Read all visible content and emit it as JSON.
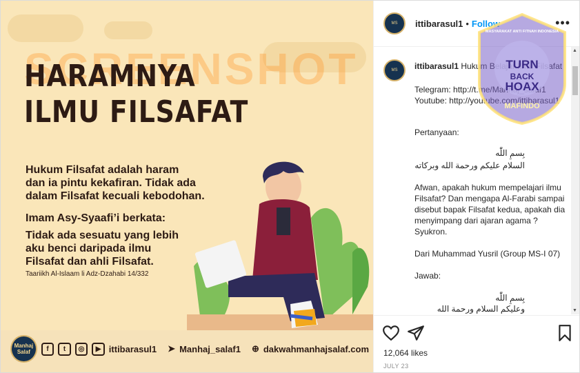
{
  "poster": {
    "title_line1": "HARAMNYA",
    "title_line2": "ILMU FILSAFAT",
    "para1_line1": "Hukum Filsafat adalah haram",
    "para1_line2": "dan ia pintu kekafiran. Tidak ada",
    "para1_line3": "dalam Filsafat kecuali kebodohan.",
    "para2": "Imam Asy-Syaafi’i berkata:",
    "para3_line1": "Tidak ada sesuatu yang lebih",
    "para3_line2": "aku benci daripada ilmu",
    "para3_line3": "Filsafat dan ahli Filsafat.",
    "reference": "Taariikh Al-Islaam li Adz-Dzahabi 14/332",
    "watermark": "SCREENSHOT BY",
    "logo_text": "Manhaj Salaf",
    "footer_handle1": "ittibarasul1",
    "footer_handle2": "Manhaj_salaf1",
    "footer_site": "dakwahmanhajsalaf.com"
  },
  "header": {
    "username": "ittibarasul1",
    "separator": "•",
    "follow_label": "Follow",
    "more_label": "•••"
  },
  "caption": {
    "username": "ittibarasul1",
    "line_title": "Hukum Belajar Ilmu Filsafat",
    "telegram": "Telegram: http://t.me/Manhaj_salaf1",
    "youtube": "Youtube: http://youtube.com/ittibarasul1",
    "question_label": "Pertanyaan:",
    "basmala": "بِسمِ اللّٰه",
    "salam": "السلام عليكم ورحمة الله وبركاته",
    "question_body": "Afwan, apakah hukum mempelajari ilmu Filsafat? Dan mengapa Al-Farabi sampai disebut bapak Filsafat kedua, apakah dia menyimpang dari ajaran agama ? Syukron.",
    "from": "Dari Muhammad Yusril (Group MS-I 07)",
    "answer_label": "Jawab:",
    "basmala2": "بِسمِ اللّٰه",
    "salam_reply": "وعليكم السلام ورحمة الله وبركاته"
  },
  "footer": {
    "likes": "12,064 likes",
    "date": "JULY 23"
  },
  "badge": {
    "ring_text": "MASYARAKAT ANTI FITNAH INDONESIA",
    "line1": "TURN",
    "line2": "BACK",
    "line3": "HOAX",
    "bottom": "MAFINDO"
  },
  "colors": {
    "poster_bg": "#fae6b9",
    "title": "#2d1b14",
    "follow": "#0095f6",
    "badge": "#7a63c8"
  }
}
